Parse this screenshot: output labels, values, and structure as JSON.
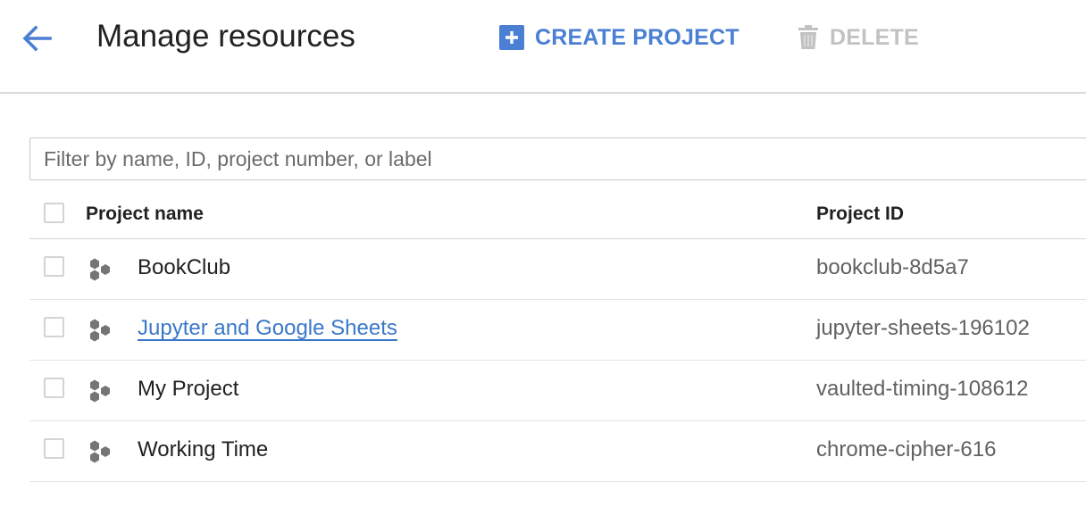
{
  "header": {
    "title": "Manage resources",
    "back_icon": "arrow-back-icon",
    "create_label": "CREATE PROJECT",
    "create_icon": "add-box-icon",
    "delete_label": "DELETE",
    "delete_icon": "trash-icon"
  },
  "colors": {
    "accent": "#4a7fd4",
    "link": "#3b78c9",
    "disabled": "#c2c2c2",
    "project_icon": "#757575"
  },
  "filter": {
    "placeholder": "Filter by name, ID, project number, or label",
    "value": ""
  },
  "table": {
    "columns": [
      "Project name",
      "Project ID"
    ],
    "rows": [
      {
        "name": "BookClub",
        "id": "bookclub-8d5a7",
        "linked": false
      },
      {
        "name": "Jupyter and Google Sheets",
        "id": "jupyter-sheets-196102",
        "linked": true
      },
      {
        "name": "My Project",
        "id": "vaulted-timing-108612",
        "linked": false
      },
      {
        "name": "Working Time",
        "id": "chrome-cipher-616",
        "linked": false
      }
    ]
  }
}
